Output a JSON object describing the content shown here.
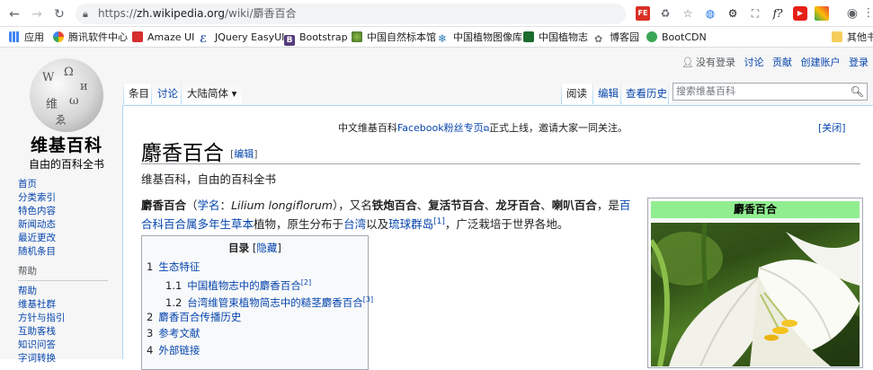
{
  "browser": {
    "url_scheme": "https://",
    "url_host": "zh.wikipedia.org",
    "url_path": "/wiki/麝香百合",
    "bookmarks": [
      "应用",
      "腾讯软件中心",
      "Amaze UI",
      "JQuery EasyUI",
      "Bootstrap",
      "中国自然标本馆",
      "中国植物图像库",
      "中国植物志",
      "博客园",
      "BootCDN",
      "其他书"
    ]
  },
  "wiki": {
    "logo_text": "维基百科",
    "logo_tagline": "自由的百科全书",
    "sidebar": {
      "nav": [
        "首页",
        "分类索引",
        "特色内容",
        "新闻动态",
        "最近更改",
        "随机条目"
      ],
      "help_heading": "帮助",
      "help": [
        "帮助",
        "维基社群",
        "方针与指引",
        "互助客栈",
        "知识问答",
        "字词转换"
      ]
    },
    "personal": {
      "anon": "没有登录",
      "talk": "讨论",
      "contrib": "贡献",
      "create": "创建账户",
      "login": "登录"
    },
    "tabs": {
      "article": "条目",
      "talk": "讨论",
      "variant": "大陆简体 ▾",
      "read": "阅读",
      "edit": "编辑",
      "history": "查看历史"
    },
    "search_placeholder": "搜索维基百科",
    "sitenotice_prefix": "中文维基百科",
    "sitenotice_link": "Facebook粉丝专页",
    "sitenotice_suffix": "正式上线，邀请大家一同关注。",
    "dismiss": "[关闭]",
    "title": "麝香百合",
    "title_edit_open": "[",
    "title_edit": "编辑",
    "title_edit_close": "]",
    "site_sub": "维基百科，自由的百科全书",
    "lead": {
      "b1": "麝香百合",
      "t1": "（",
      "a1": "学名",
      "t2": "：",
      "sci": "Lilium longiflorum",
      "t3": "），又名",
      "b2": "铁炮百合",
      "t4": "、",
      "b3": "复活节百合",
      "t5": "、",
      "b4": "龙牙百合",
      "t6": "、",
      "b5": "喇叭百合",
      "t7": "，是",
      "a2": "百合科",
      "a3": "百合属",
      "a4": "多年生草本",
      "t8": "植物，原生分布于",
      "a5": "台湾",
      "t9": "以及",
      "a6": "琉球群岛",
      "ref": "[1]",
      "t10": "，广泛栽培于世界各地。"
    },
    "toc": {
      "title": "目录",
      "toggle_open": " [",
      "toggle": "隐藏",
      "toggle_close": "]",
      "items": [
        {
          "num": "1",
          "label": "生态特征",
          "ref": ""
        },
        {
          "num": "1.1",
          "label": "中国植物志中的麝香百合",
          "ref": "[2]"
        },
        {
          "num": "1.2",
          "label": "台湾维管束植物简志中的糙茎麝香百合",
          "ref": "[3]"
        },
        {
          "num": "2",
          "label": "麝香百合传播历史",
          "ref": ""
        },
        {
          "num": "3",
          "label": "参考文献",
          "ref": ""
        },
        {
          "num": "4",
          "label": "外部链接",
          "ref": ""
        }
      ]
    },
    "infobox_title": "麝香百合"
  }
}
